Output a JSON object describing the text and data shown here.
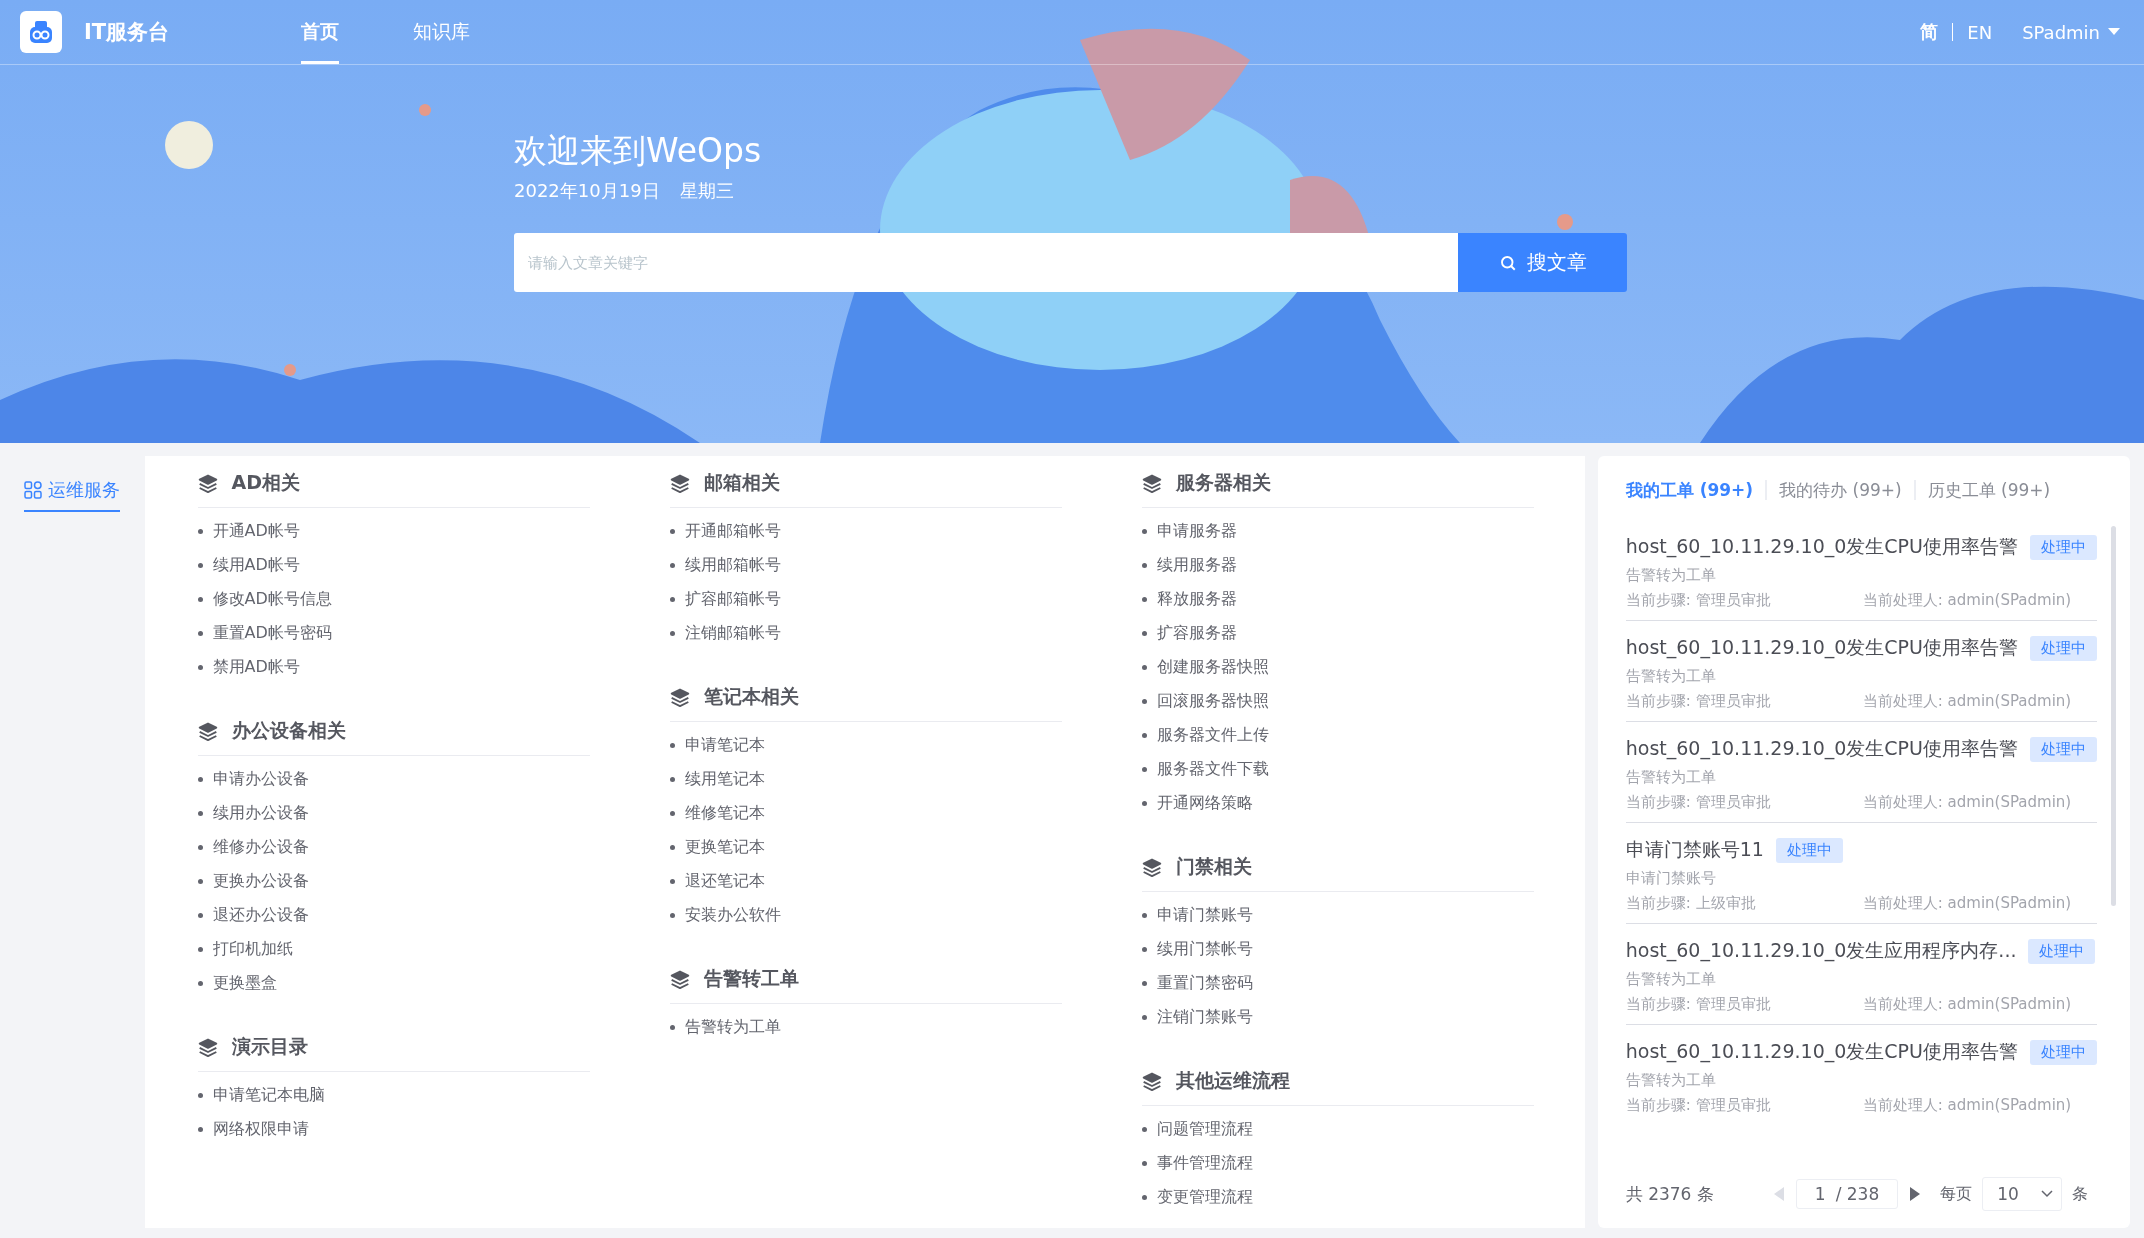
{
  "header": {
    "app_name": "IT服务台",
    "nav": [
      {
        "label": "首页",
        "selected": true
      },
      {
        "label": "知识库",
        "selected": false
      }
    ],
    "languages": [
      {
        "label": "简",
        "selected": true
      },
      {
        "label": "EN",
        "selected": false
      }
    ],
    "user": "SPadmin"
  },
  "hero": {
    "title": "欢迎来到WeOps",
    "date": "2022年10月19日",
    "weekday": "星期三",
    "search": {
      "placeholder": "请输入文章关键字",
      "button": "搜文章"
    }
  },
  "sidebar": {
    "items": [
      {
        "label": "运维服务",
        "selected": true
      }
    ]
  },
  "catalog": {
    "columns": [
      [
        {
          "title": "AD相关",
          "items": [
            "开通AD帐号",
            "续用AD帐号",
            "修改AD帐号信息",
            "重置AD帐号密码",
            "禁用AD帐号"
          ]
        },
        {
          "title": "办公设备相关",
          "items": [
            "申请办公设备",
            "续用办公设备",
            "维修办公设备",
            "更换办公设备",
            "退还办公设备",
            "打印机加纸",
            "更换墨盒"
          ]
        },
        {
          "title": "演示目录",
          "items": [
            "申请笔记本电脑",
            "网络权限申请"
          ]
        }
      ],
      [
        {
          "title": "邮箱相关",
          "items": [
            "开通邮箱帐号",
            "续用邮箱帐号",
            "扩容邮箱帐号",
            "注销邮箱帐号"
          ]
        },
        {
          "title": "笔记本相关",
          "items": [
            "申请笔记本",
            "续用笔记本",
            "维修笔记本",
            "更换笔记本",
            "退还笔记本",
            "安装办公软件"
          ]
        },
        {
          "title": "告警转工单",
          "items": [
            "告警转为工单"
          ]
        }
      ],
      [
        {
          "title": "服务器相关",
          "items": [
            "申请服务器",
            "续用服务器",
            "释放服务器",
            "扩容服务器",
            "创建服务器快照",
            "回滚服务器快照",
            "服务器文件上传",
            "服务器文件下载",
            "开通网络策略"
          ]
        },
        {
          "title": "门禁相关",
          "items": [
            "申请门禁账号",
            "续用门禁帐号",
            "重置门禁密码",
            "注销门禁账号"
          ]
        },
        {
          "title": "其他运维流程",
          "items": [
            "问题管理流程",
            "事件管理流程",
            "变更管理流程"
          ]
        }
      ]
    ]
  },
  "tickets": {
    "tabs": [
      {
        "label": "我的工单 (99+)",
        "selected": true
      },
      {
        "label": "我的待办 (99+)",
        "selected": false
      },
      {
        "label": "历史工单 (99+)",
        "selected": false
      }
    ],
    "items": [
      {
        "title": "host_60_10.11.29.10_0发生CPU使用率告警",
        "status": "处理中",
        "service": "告警转为工单",
        "step": "当前步骤: 管理员审批",
        "handler": "当前处理人: admin(SPadmin)"
      },
      {
        "title": "host_60_10.11.29.10_0发生CPU使用率告警",
        "status": "处理中",
        "service": "告警转为工单",
        "step": "当前步骤: 管理员审批",
        "handler": "当前处理人: admin(SPadmin)"
      },
      {
        "title": "host_60_10.11.29.10_0发生CPU使用率告警",
        "status": "处理中",
        "service": "告警转为工单",
        "step": "当前步骤: 管理员审批",
        "handler": "当前处理人: admin(SPadmin)"
      },
      {
        "title": "申请门禁账号11",
        "status": "处理中",
        "service": "申请门禁账号",
        "step": "当前步骤: 上级审批",
        "handler": "当前处理人: admin(SPadmin)"
      },
      {
        "title": "host_60_10.11.29.10_0发生应用程序内存...",
        "status": "处理中",
        "service": "告警转为工单",
        "step": "当前步骤: 管理员审批",
        "handler": "当前处理人: admin(SPadmin)"
      },
      {
        "title": "host_60_10.11.29.10_0发生CPU使用率告警",
        "status": "处理中",
        "service": "告警转为工单",
        "step": "当前步骤: 管理员审批",
        "handler": "当前处理人: admin(SPadmin)"
      }
    ],
    "pagination": {
      "total": "共 2376 条",
      "page": "1",
      "pages": "/ 238",
      "per_page_label": "每页",
      "per_page": "10",
      "unit": "条"
    }
  }
}
